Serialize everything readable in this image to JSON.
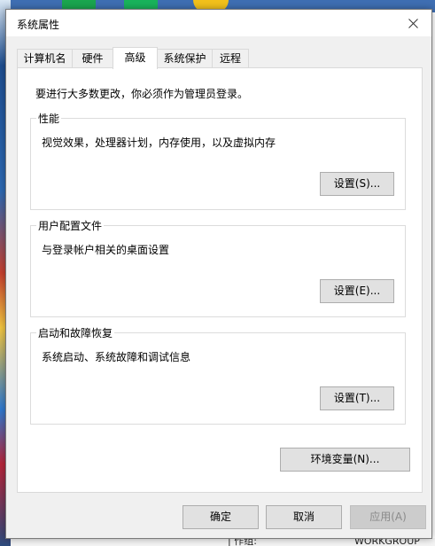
{
  "window": {
    "title": "系统属性"
  },
  "tabs": [
    {
      "label": "计算机名"
    },
    {
      "label": "硬件"
    },
    {
      "label": "高级"
    },
    {
      "label": "系统保护"
    },
    {
      "label": "远程"
    }
  ],
  "advanced": {
    "admin_note": "要进行大多数更改，你必须作为管理员登录。",
    "performance": {
      "title": "性能",
      "description": "视觉效果，处理器计划，内存使用，以及虚拟内存",
      "button": "设置(S)..."
    },
    "user_profiles": {
      "title": "用户配置文件",
      "description": "与登录帐户相关的桌面设置",
      "button": "设置(E)..."
    },
    "startup_recovery": {
      "title": "启动和故障恢复",
      "description": "系统启动、系统故障和调试信息",
      "button": "设置(T)..."
    },
    "env_button": "环境变量(N)..."
  },
  "footer": {
    "ok": "确定",
    "cancel": "取消",
    "apply": "应用(A)"
  },
  "background": {
    "bottom_left": "| 作组:",
    "bottom_right": "WORKGROUP"
  },
  "colors": {
    "dialog_bg": "#f0f0f0",
    "page_bg": "#ffffff",
    "button_bg": "#e1e1e1",
    "button_border": "#adadad",
    "disabled_text": "#8a8a8a"
  }
}
